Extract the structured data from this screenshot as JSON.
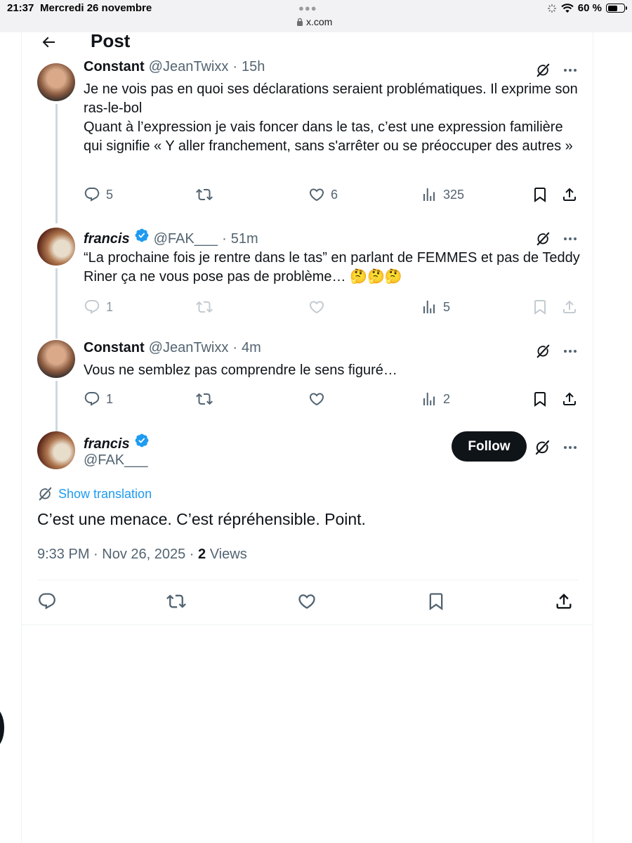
{
  "status": {
    "time": "21:37",
    "date": "Mercredi 26 novembre",
    "url": "x.com",
    "battery": "60 %",
    "battery_level": 0.6
  },
  "header": {
    "title": "Post"
  },
  "thread": [
    {
      "name": "Constant",
      "handle": "@JeanTwixx",
      "time": "15h",
      "text": [
        "Je ne vois pas en quoi ses déclarations seraient problématiques. Il exprime son ras-le-bol",
        "Quant à l’expression je vais foncer dans le tas, c’est une expression familière qui signifie « Y aller franchement, sans s'arrêter ou se préoccuper des autres »"
      ],
      "replies": "5",
      "retweets": "",
      "likes": "6",
      "views": "325"
    },
    {
      "name": "francis",
      "handle": "@FAK___",
      "time": "51m",
      "text": [
        "“La prochaine fois je rentre dans le tas” en parlant de FEMMES et pas de Teddy Riner ça ne vous pose pas de problème… 🤔🤔🤔"
      ],
      "replies": "1",
      "retweets": "",
      "likes": "",
      "views": "5"
    },
    {
      "name": "Constant",
      "handle": "@JeanTwixx",
      "time": "4m",
      "text": [
        "Vous ne semblez pas comprendre le sens figuré…"
      ],
      "replies": "1",
      "retweets": "",
      "likes": "",
      "views": "2"
    }
  ],
  "main_post": {
    "name": "francis",
    "handle": "@FAK___",
    "follow_label": "Follow",
    "translate_label": "Show translation",
    "text": "C’est une menace. C’est répréhensible. Point.",
    "timestamp": "9:33 PM · Nov 26, 2025 · ",
    "views_count": "2",
    "views_label": "Views"
  },
  "colors": {
    "accent": "#1d9bf0",
    "text": "#0f1419",
    "muted": "#536471",
    "verified": "#1d9bf0"
  }
}
